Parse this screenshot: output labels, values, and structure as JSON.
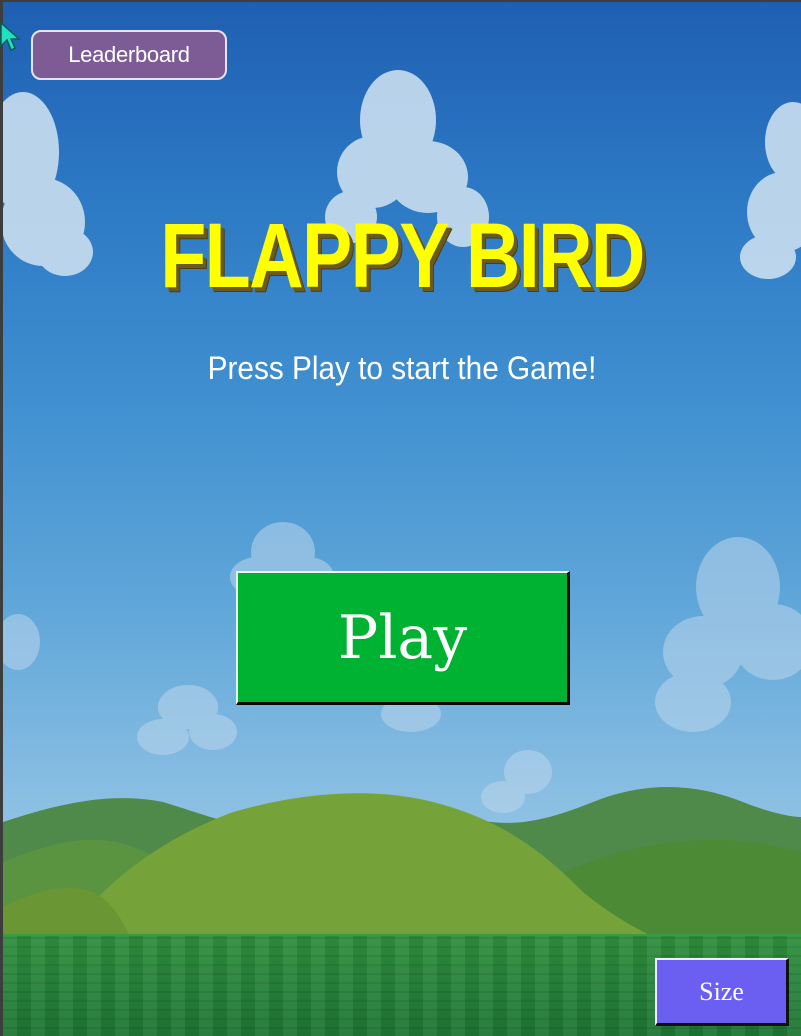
{
  "game": {
    "title": "FLAPPY BIRD",
    "subtitle": "Press Play to start the Game!",
    "leaderboard_label": "Leaderboard",
    "play_label": "Play",
    "size_label": "Size"
  },
  "colors": {
    "sky_top": "#1f5fb2",
    "sky_bottom": "#a8d0e8",
    "title": "#ffff00",
    "title_shadow": "#6b5a1e",
    "play_button": "#00b232",
    "leaderboard_button": "#7d5c96",
    "size_button": "#6b5ff2",
    "grass": "#26823a",
    "hills_near": "#6e9e3a",
    "hills_far": "#4f8a4a",
    "cursor": "#20e0c0"
  },
  "icons": {
    "cursor": "mouse-pointer-icon"
  }
}
